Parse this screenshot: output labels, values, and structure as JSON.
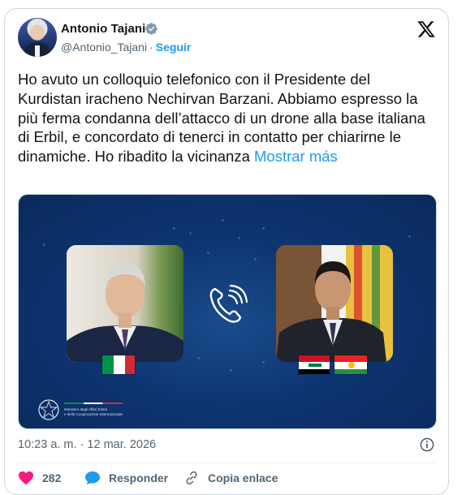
{
  "author": {
    "name": "Antonio Tajani",
    "handle": "@Antonio_Tajani",
    "separator": "·",
    "follow_label": "Seguir"
  },
  "tweet": {
    "text": "Ho avuto un colloquio telefonico con il Presidente del Kurdistan iracheno Nechirvan Barzani. Abbiamo espresso la più ferma condanna dell’attacco di un drone alla base italiana di Erbil, e concordato di tenerci in contatto per chiarirne le dinamiche. Ho ribadito la vicinanza",
    "more_label": "Mostrar más"
  },
  "media": {
    "ministry_line1": "Ministero degli Affari Esteri",
    "ministry_line2": "e della Cooperazione Internazionale"
  },
  "meta": {
    "timestamp": "10:23 a. m. · 12 mar. 2026"
  },
  "actions": {
    "likes_count": "282",
    "reply_label": "Responder",
    "copy_link_label": "Copia enlace"
  },
  "colors": {
    "accent": "#1d9bf0",
    "like": "#f91880",
    "text": "#0f1419",
    "muted": "#536471",
    "media_bg": "#0e3572"
  },
  "icons": [
    "verified-badge-icon",
    "x-logo-icon",
    "phone-call-icon",
    "info-icon",
    "heart-icon",
    "reply-bubble-icon",
    "link-icon"
  ]
}
